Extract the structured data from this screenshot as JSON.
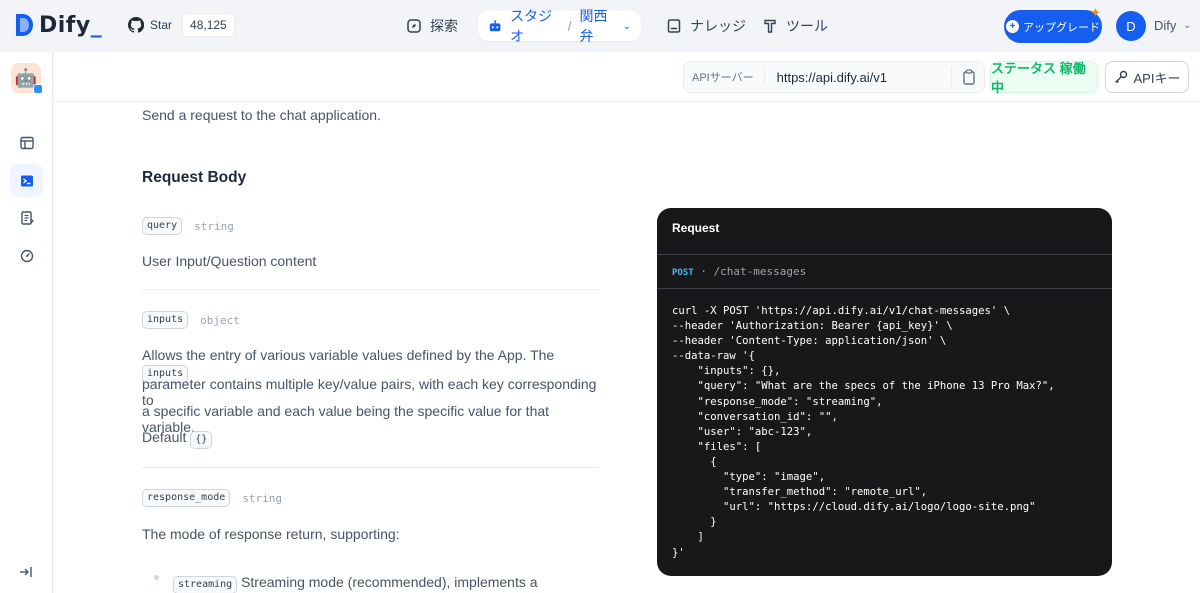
{
  "brand": {
    "name": "Dify",
    "cursor": "_"
  },
  "github": {
    "label": "Star",
    "count": "48,125"
  },
  "nav": {
    "explore": "探索",
    "studio": "スタジオ",
    "studio_app": "関西弁",
    "knowledge": "ナレッジ",
    "tools": "ツール"
  },
  "account": {
    "upgrade": "アップグレード",
    "avatar_initial": "D",
    "name": "Dify"
  },
  "api_bar": {
    "server_label": "APIサーバー",
    "url": "https://api.dify.ai/v1",
    "status": "ステータス 稼働中",
    "api_key": "APIキー"
  },
  "doc": {
    "intro": "Send a request to the chat application.",
    "section_title": "Request Body",
    "params": [
      {
        "name": "query",
        "type": "string",
        "desc": "User Input/Question content"
      },
      {
        "name": "inputs",
        "type": "object",
        "desc_before": "Allows the entry of various variable values defined by the App. The",
        "desc_inline": "inputs",
        "desc_after": "parameter contains multiple key/value pairs, with each key corresponding to",
        "desc_line3": "a specific variable and each value being the specific value for that variable.",
        "default_label": "Default",
        "default_value": "{}"
      },
      {
        "name": "response_mode",
        "type": "string",
        "desc": "The mode of response return, supporting:"
      }
    ],
    "bullet_tag": "streaming",
    "bullet_text": "Streaming mode (recommended), implements a typewriter-"
  },
  "code_panel": {
    "title": "Request",
    "method": "POST",
    "dot": "·",
    "path": "/chat-messages",
    "code": "curl -X POST 'https://api.dify.ai/v1/chat-messages' \\\n--header 'Authorization: Bearer {api_key}' \\\n--header 'Content-Type: application/json' \\\n--data-raw '{\n    \"inputs\": {},\n    \"query\": \"What are the specs of the iPhone 13 Pro Max?\",\n    \"response_mode\": \"streaming\",\n    \"conversation_id\": \"\",\n    \"user\": \"abc-123\",\n    \"files\": [\n      {\n        \"type\": \"image\",\n        \"transfer_method\": \"remote_url\",\n        \"url\": \"https://cloud.dify.ai/logo/logo-site.png\"\n      }\n    ]\n}'"
  },
  "colors": {
    "accent": "#155eef",
    "status_green": "#12b76a",
    "code_bg": "#18181b"
  }
}
